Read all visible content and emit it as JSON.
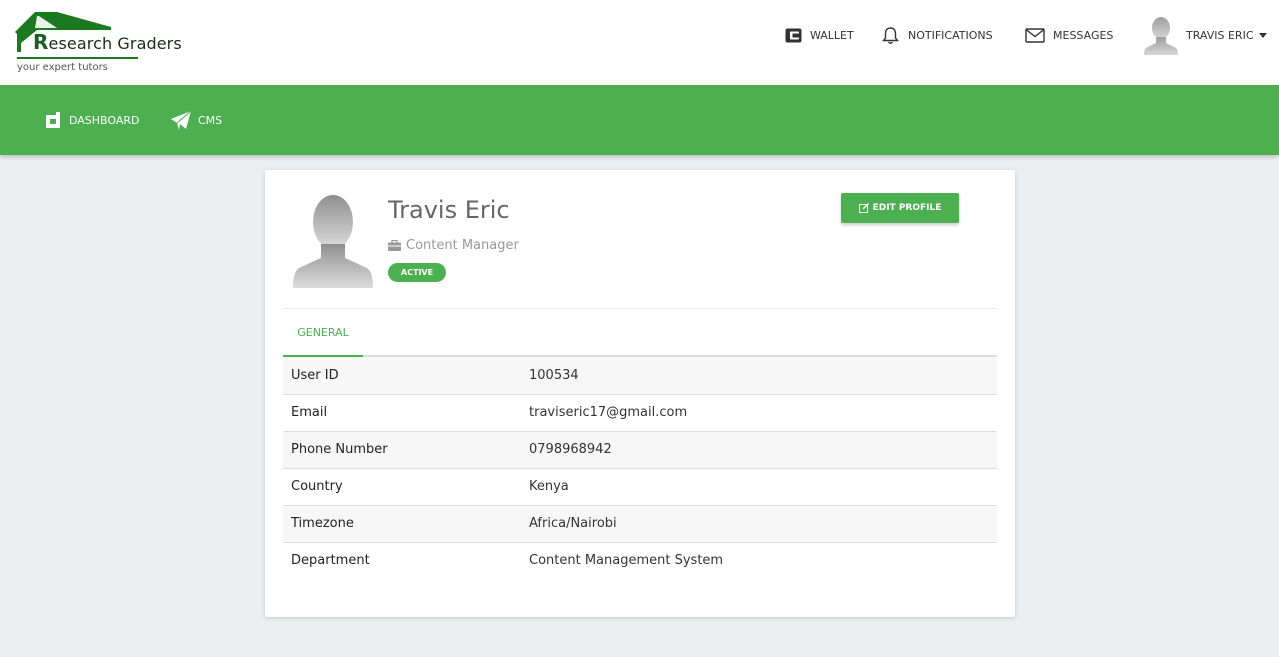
{
  "brand": {
    "name_first_letter": "R",
    "name_rest": "esearch Graders",
    "tagline": "your expert tutors"
  },
  "header_nav": {
    "wallet": "WALLET",
    "notifications": "NOTIFICATIONS",
    "messages": "MESSAGES",
    "user": "TRAVIS ERIC"
  },
  "main_nav": {
    "dashboard": "DASHBOARD",
    "cms": "CMS"
  },
  "profile": {
    "name": "Travis Eric",
    "role": "Content Manager",
    "status": "ACTIVE",
    "edit_label": "EDIT PROFILE"
  },
  "tabs": {
    "general": "GENERAL"
  },
  "details": [
    {
      "label": "User ID",
      "value": "100534"
    },
    {
      "label": "Email",
      "value": "traviseric17@gmail.com"
    },
    {
      "label": "Phone Number",
      "value": "0798968942"
    },
    {
      "label": "Country",
      "value": "Kenya"
    },
    {
      "label": "Timezone",
      "value": "Africa/Nairobi"
    },
    {
      "label": "Department",
      "value": "Content Management System"
    }
  ],
  "colors": {
    "accent": "#4caf50",
    "brand_dark": "#1b5e20"
  }
}
